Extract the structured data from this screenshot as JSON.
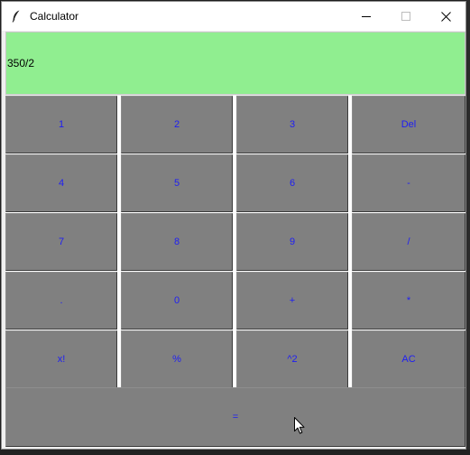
{
  "window": {
    "title": "Calculator",
    "app_icon": "feather-icon",
    "controls": [
      "minimize-icon",
      "maximize-icon",
      "close-icon"
    ]
  },
  "display": {
    "expression": "350/2",
    "background": "#90ee90"
  },
  "keypad": {
    "button_color": "#808080",
    "label_color": "#1d1df5",
    "keys": [
      "1",
      "2",
      "3",
      "Del",
      "4",
      "5",
      "6",
      "-",
      "7",
      "8",
      "9",
      "/",
      ".",
      "0",
      "+",
      "*",
      "x!",
      "%",
      "^2",
      "AC"
    ],
    "equals": "="
  },
  "pointer": "arrow-cursor-icon"
}
